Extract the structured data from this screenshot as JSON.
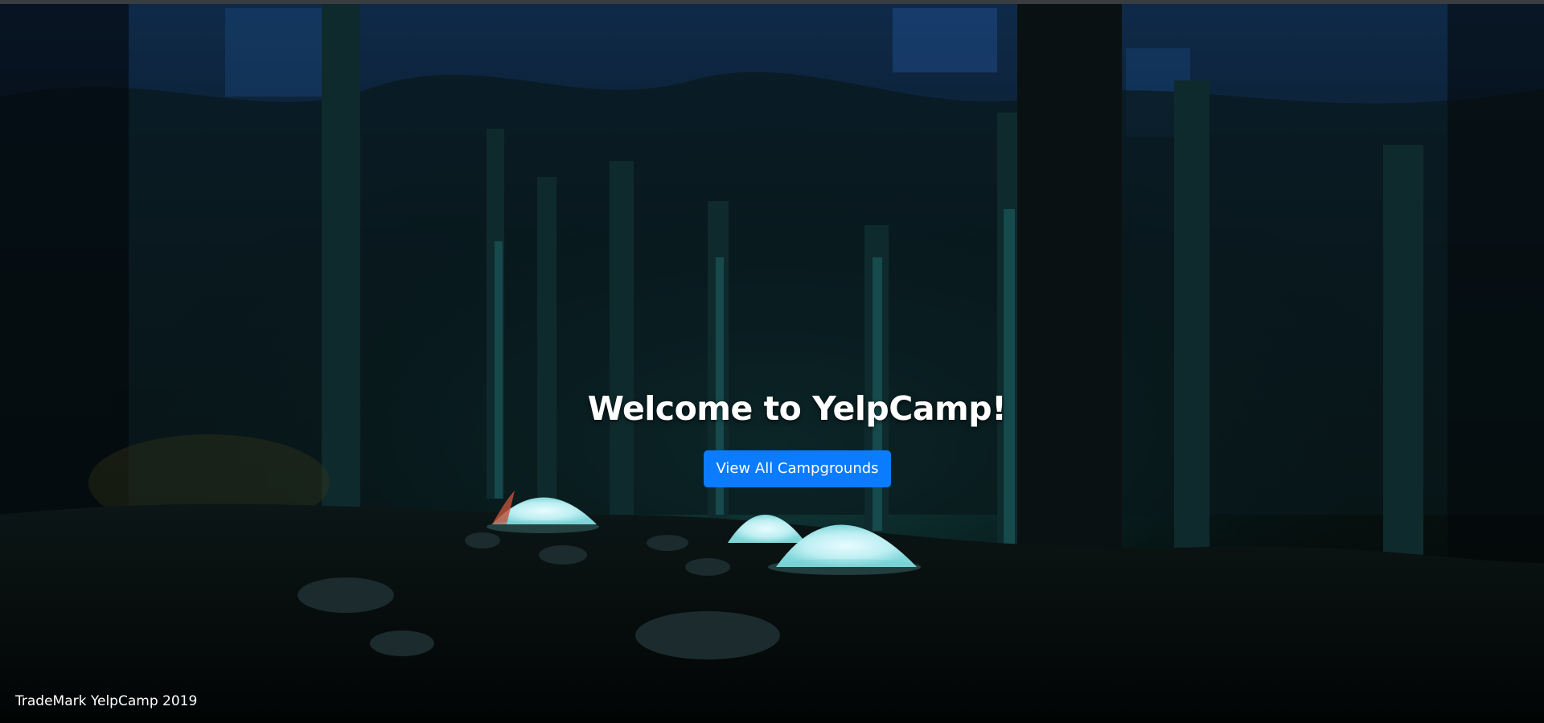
{
  "hero": {
    "title": "Welcome to YelpCamp!",
    "button_label": "View All Campgrounds"
  },
  "footer": {
    "text": "TradeMark YelpCamp 2019"
  },
  "colors": {
    "button": "#0b7bff",
    "text": "#ffffff",
    "background": "#050a0c"
  }
}
